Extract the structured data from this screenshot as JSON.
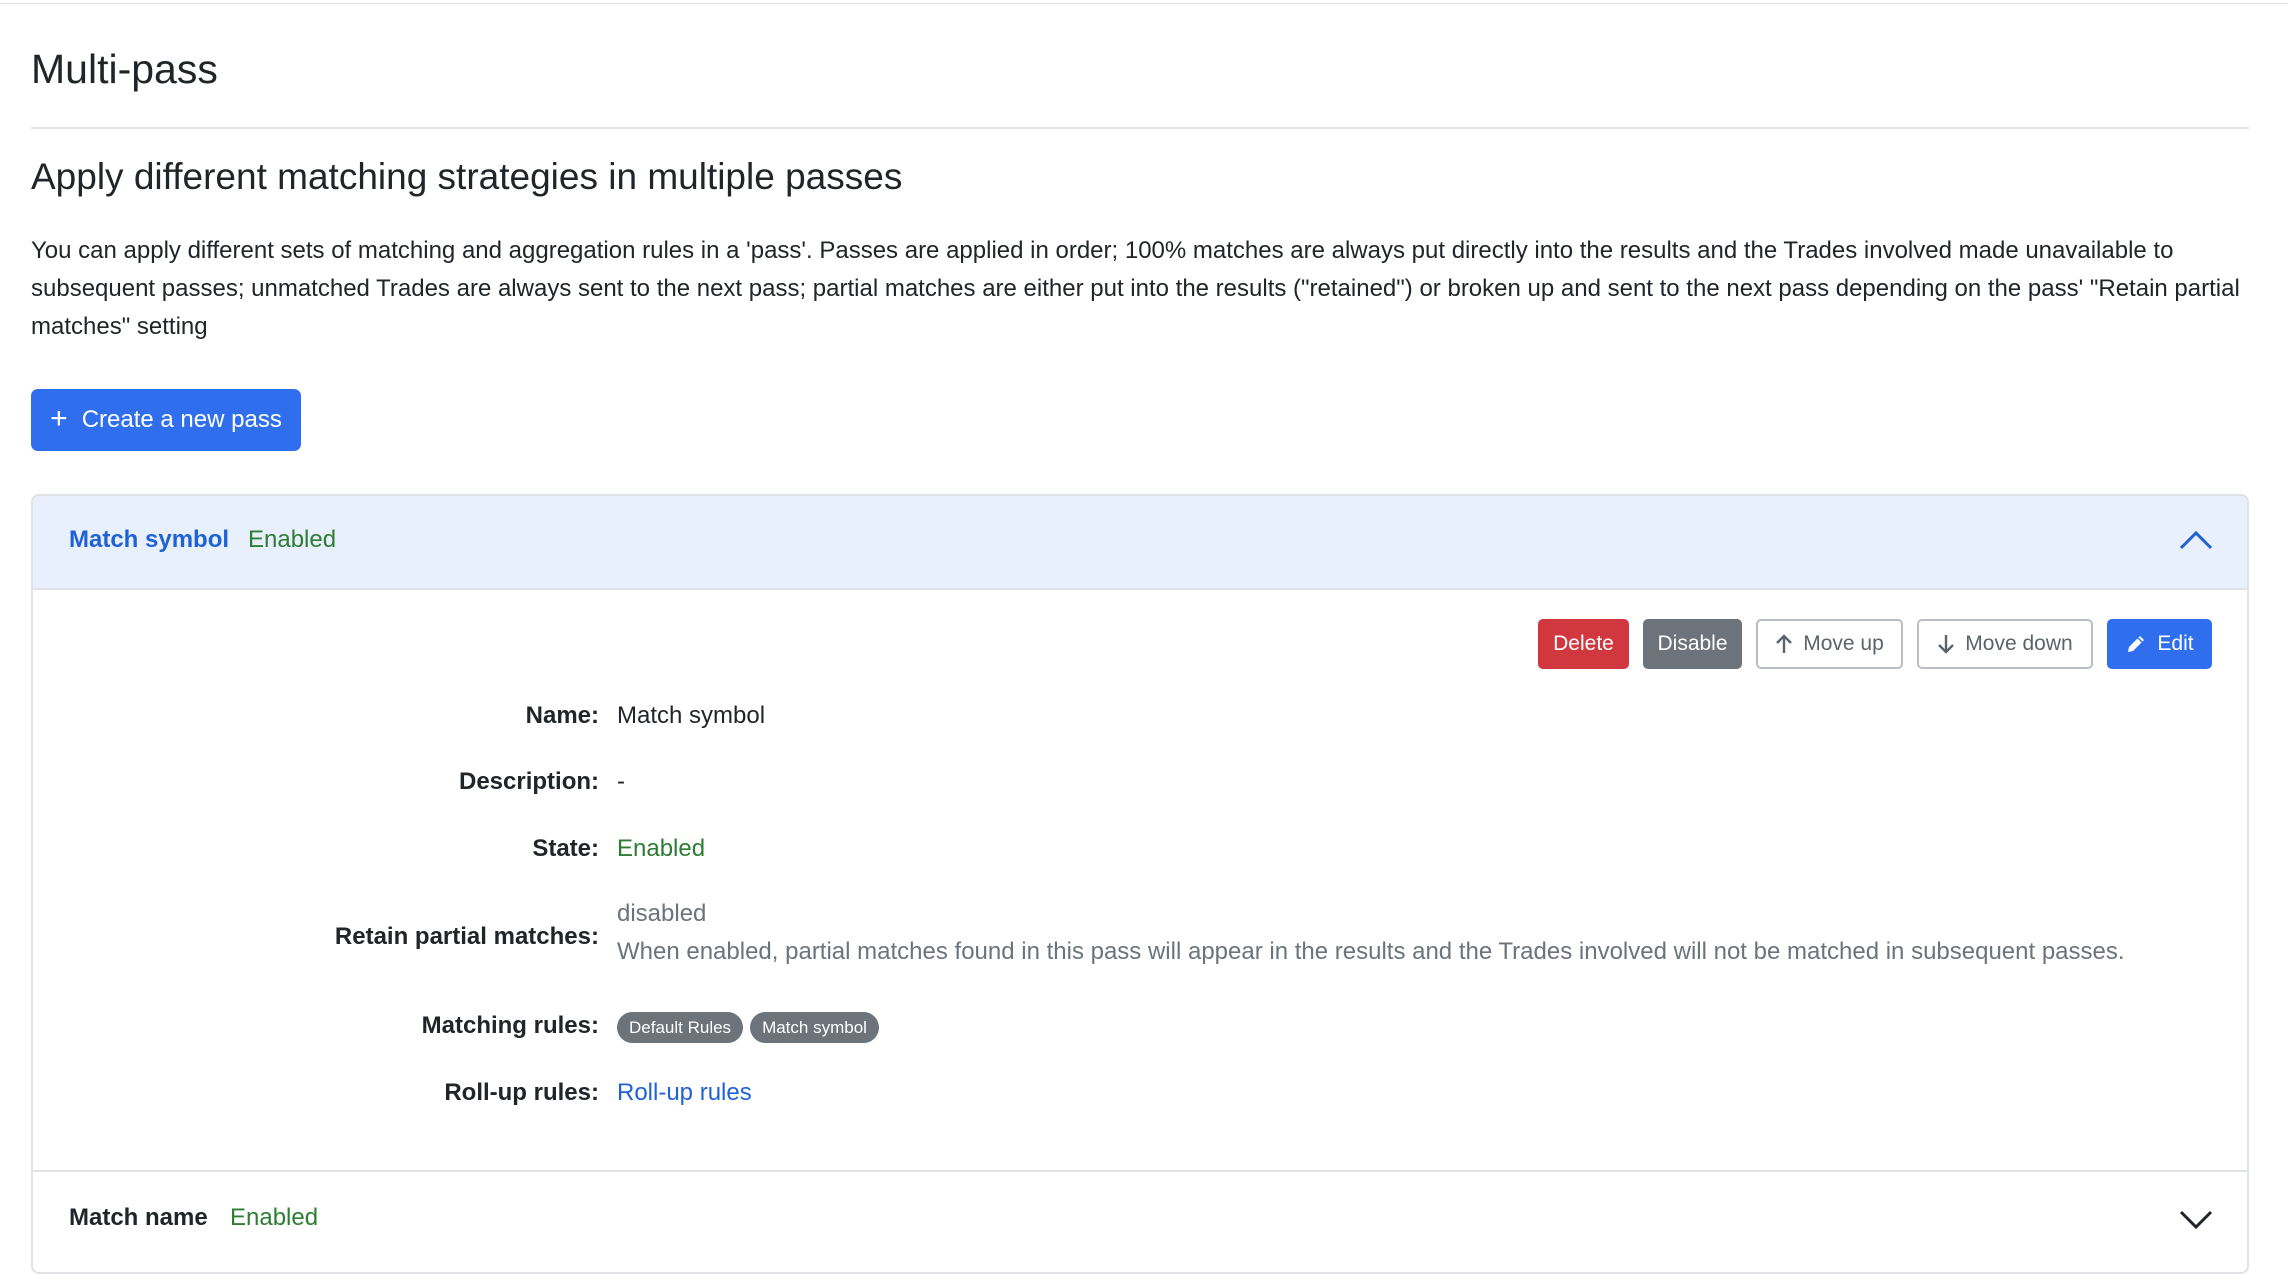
{
  "page": {
    "title": "Multi-pass",
    "section_heading": "Apply different matching strategies in multiple passes",
    "intro": "You can apply different sets of matching and aggregation rules in a 'pass'. Passes are applied in order; 100% matches are always put directly into the results and the Trades involved made unavailable to subsequent passes; unmatched Trades are always sent to the next pass; partial matches are either put into the results (\"retained\") or broken up and sent to the next pass depending on the pass' \"Retain partial matches\" setting",
    "create_button": "Create a new pass"
  },
  "passes": [
    {
      "name": "Match symbol",
      "state": "Enabled",
      "expanded": true,
      "actions": {
        "delete": "Delete",
        "disable": "Disable",
        "move_up": "Move up",
        "move_down": "Move down",
        "edit": "Edit"
      },
      "details": {
        "name_label": "Name:",
        "name_value": "Match symbol",
        "description_label": "Description:",
        "description_value": "-",
        "state_label": "State:",
        "state_value": "Enabled",
        "retain_label": "Retain partial matches:",
        "retain_value": "disabled",
        "retain_help": "When enabled, partial matches found in this pass will appear in the results and the Trades involved will not be matched in subsequent passes.",
        "matching_label": "Matching rules:",
        "matching_rules": [
          "Default Rules",
          "Match symbol"
        ],
        "rollup_label": "Roll-up rules:",
        "rollup_value": "Roll-up rules"
      }
    },
    {
      "name": "Match name",
      "state": "Enabled",
      "expanded": false
    }
  ],
  "colors": {
    "primary": "#2f6fed",
    "danger": "#d1373f",
    "secondary": "#6c737b",
    "success": "#2e7d32",
    "header_bg": "#e8f0fd"
  }
}
